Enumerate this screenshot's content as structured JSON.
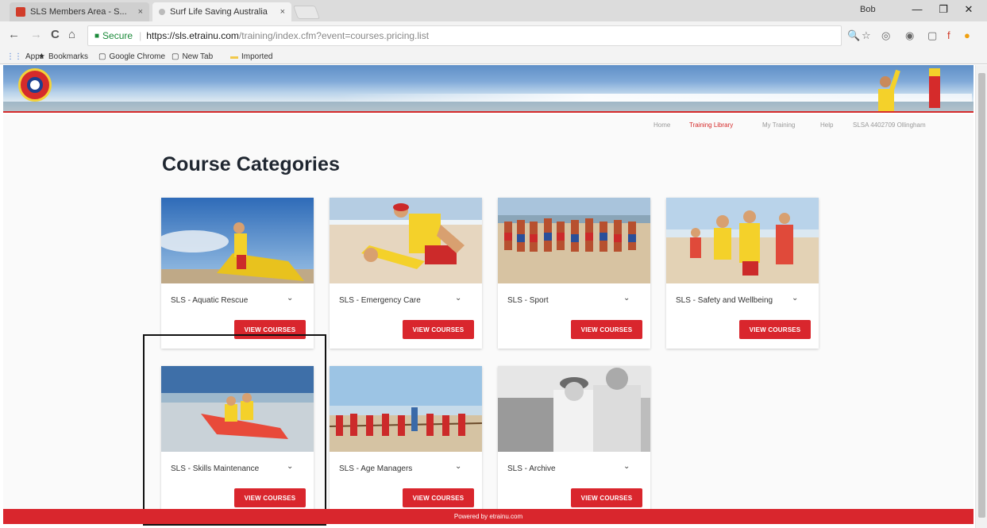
{
  "browser": {
    "tabs": [
      {
        "title": "SLS Members Area - S...",
        "close": "×",
        "favicon_color": "#d13c2a"
      },
      {
        "title": "Surf Life Saving Australia",
        "close": "×",
        "favicon_color": "#bbbbbb"
      }
    ],
    "user_name": "Bob",
    "window_controls": {
      "minimize": "—",
      "restore": "❐",
      "close": "✕"
    },
    "nav_icons": {
      "back": "←",
      "forward": "→",
      "reload": "C",
      "home": "⌂"
    },
    "secure_label": "Secure",
    "separator": "|",
    "url_host": "https://sls.etrainu.com",
    "url_path": "/training/index.cfm?event=courses.pricing.list",
    "toolbar_icons": {
      "zoom": "🔍",
      "star": "☆",
      "ext1": "◎",
      "ext2": "◉",
      "ext3": "▢",
      "ext4": "f",
      "ext5": "●"
    },
    "bookmarks": [
      {
        "label": "Apps",
        "icon": "grid-icon"
      },
      {
        "label": "Bookmarks",
        "icon": "star-icon"
      },
      {
        "label": "Google Chrome",
        "icon": "page-icon"
      },
      {
        "label": "New Tab",
        "icon": "page-icon"
      },
      {
        "label": "Imported",
        "icon": "folder-icon"
      }
    ],
    "bookmark_glyphs": {
      "apps": "⋮⋮",
      "bookmarks": "★",
      "page": "▢",
      "folder": "▬"
    }
  },
  "site": {
    "nav": [
      {
        "label": "Home",
        "active": false
      },
      {
        "label": "Training Library",
        "active": true
      },
      {
        "label": "My Training",
        "active": false
      },
      {
        "label": "Help",
        "active": false
      },
      {
        "label": "SLSA 4402709 Ollingham",
        "active": false
      }
    ],
    "title": "Course Categories",
    "button_label": "VIEW COURSES",
    "chevron": "⌄",
    "categories": [
      {
        "label": "SLS - Aquatic Rescue"
      },
      {
        "label": "SLS - Emergency Care"
      },
      {
        "label": "SLS - Sport"
      },
      {
        "label": "SLS - Safety and Wellbeing"
      },
      {
        "label": "SLS - Skills Maintenance"
      },
      {
        "label": "SLS - Age Managers"
      },
      {
        "label": "SLS - Archive"
      }
    ],
    "footer": "Powered by etrainu.com"
  },
  "colors": {
    "brand_red": "#d9262d",
    "title_dark": "#1f2630",
    "nav_active": "#d52b2b"
  }
}
